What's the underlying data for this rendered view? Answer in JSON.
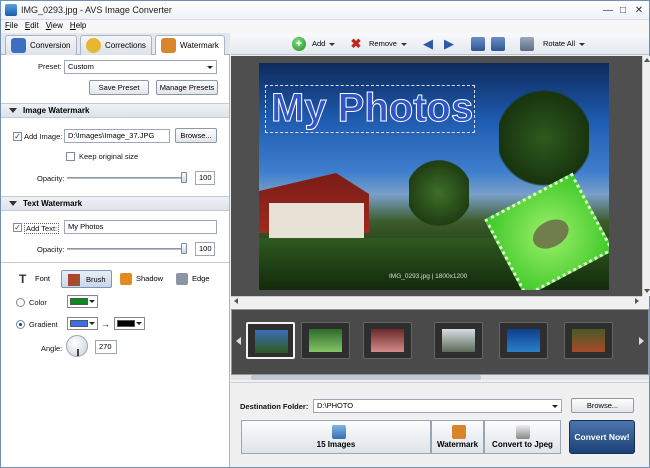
{
  "window": {
    "title": "IMG_0293.jpg - AVS Image Converter"
  },
  "menu": [
    "File",
    "Edit",
    "View",
    "Help"
  ],
  "tabs": [
    {
      "label": "Conversion"
    },
    {
      "label": "Corrections"
    },
    {
      "label": "Watermark"
    }
  ],
  "preset": {
    "label": "Preset:",
    "value": "Custom",
    "save": "Save Preset",
    "manage": "Manage Presets"
  },
  "image_watermark": {
    "header": "Image Watermark",
    "add_image_label": "Add Image:",
    "add_image_checked": true,
    "path": "D:\\Images\\Image_37.JPG",
    "browse": "Browse...",
    "keep_original": "Keep original size",
    "opacity_label": "Opacity:",
    "opacity": "100"
  },
  "text_watermark": {
    "header": "Text Watermark",
    "add_text_label": "Add Text:",
    "add_text_checked": true,
    "text": "My Photos",
    "opacity_label": "Opacity:",
    "opacity": "100",
    "styles": [
      "Font",
      "Brush",
      "Shadow",
      "Edge"
    ],
    "color_label": "Color",
    "gradient_label": "Gradient",
    "angle_label": "Angle:",
    "angle": "270",
    "colors": {
      "color": "#0a8a1a",
      "grad_start": "#3c6ee8",
      "grad_end": "#000000"
    }
  },
  "toolbar": {
    "add": "Add",
    "remove": "Remove",
    "rotate_all": "Rotate All"
  },
  "preview": {
    "watermark_text": "My Photos",
    "info": "IMG_0293.jpg | 1800x1200"
  },
  "thumbnails": [
    "thumb-1",
    "thumb-2",
    "thumb-3",
    "thumb-4",
    "thumb-5",
    "thumb-6"
  ],
  "destination": {
    "label": "Destination Folder:",
    "value": "D:\\PHOTO",
    "browse": "Browse..."
  },
  "steps": {
    "images": "15 Images",
    "watermark": "Watermark",
    "convert_to": "Convert to Jpeg"
  },
  "convert_now": "Convert Now!"
}
